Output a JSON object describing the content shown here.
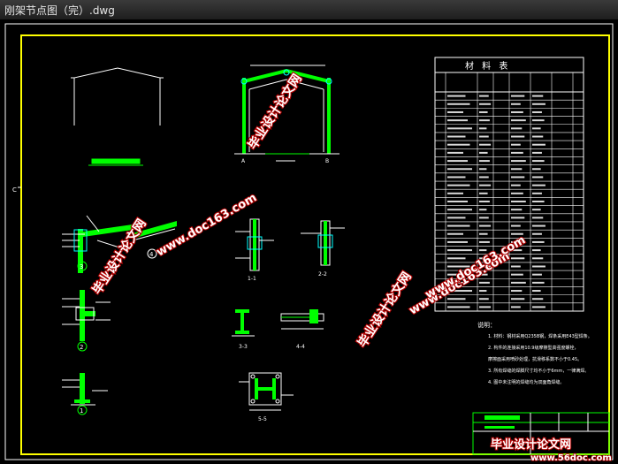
{
  "window": {
    "title": "刚架节点图（完）.dwg"
  },
  "drawing": {
    "material_table_title": "材 料 表",
    "material_table_rows": 27,
    "notes_heading": "说明：",
    "notes": [
      "1. 材料：钢材采用Q235B钢，焊条采用E43型焊条。",
      "2. 构件的连接采用10.9级摩擦型高强度螺栓，",
      "   摩擦面采用喷砂处理，抗滑移系数不小于0.45。",
      "3. 所有焊缝的焊脚尺寸均不小于6mm，一律满焊。",
      "4. 图中未注明的焊缝均为双面角焊缝。"
    ],
    "detail_labels": [
      "3",
      "4",
      "2",
      "1"
    ],
    "section_labels": [
      "1-1",
      "2-2",
      "3-3",
      "4-4",
      "5-5",
      "6-6"
    ],
    "title_block": {
      "project_label": "毕业设计论文网"
    },
    "axis_mark": "C"
  },
  "watermarks": [
    {
      "text": "毕业设计论文网",
      "color": "#ffffff"
    },
    {
      "text": "www.doc163.com",
      "color": "#ffffff"
    },
    {
      "text": "毕业设计论文网",
      "color": "#ffffff"
    },
    {
      "text": "www.doc163.com",
      "color": "#ffffff"
    },
    {
      "text": "毕业设计论文网",
      "color": "#ffffff"
    },
    {
      "text": "www.doc163.com",
      "color": "#ffffff"
    }
  ],
  "footer_watermark": {
    "logo": "毕业设计论文网",
    "url": "www.56doc.com"
  },
  "colors": {
    "frame": "#ffff00",
    "green": "#00ff00",
    "line": "#ffffff",
    "cyan": "#00ffff",
    "watermark_stroke": "#b00000"
  }
}
